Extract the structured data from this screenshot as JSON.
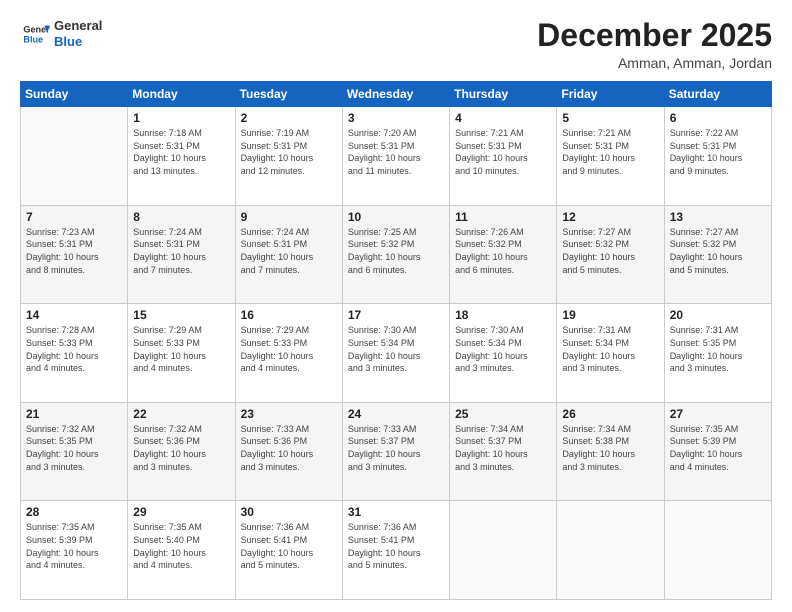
{
  "logo": {
    "general": "General",
    "blue": "Blue"
  },
  "title": "December 2025",
  "location": "Amman, Amman, Jordan",
  "days_header": [
    "Sunday",
    "Monday",
    "Tuesday",
    "Wednesday",
    "Thursday",
    "Friday",
    "Saturday"
  ],
  "weeks": [
    [
      {
        "day": "",
        "info": ""
      },
      {
        "day": "1",
        "info": "Sunrise: 7:18 AM\nSunset: 5:31 PM\nDaylight: 10 hours\nand 13 minutes."
      },
      {
        "day": "2",
        "info": "Sunrise: 7:19 AM\nSunset: 5:31 PM\nDaylight: 10 hours\nand 12 minutes."
      },
      {
        "day": "3",
        "info": "Sunrise: 7:20 AM\nSunset: 5:31 PM\nDaylight: 10 hours\nand 11 minutes."
      },
      {
        "day": "4",
        "info": "Sunrise: 7:21 AM\nSunset: 5:31 PM\nDaylight: 10 hours\nand 10 minutes."
      },
      {
        "day": "5",
        "info": "Sunrise: 7:21 AM\nSunset: 5:31 PM\nDaylight: 10 hours\nand 9 minutes."
      },
      {
        "day": "6",
        "info": "Sunrise: 7:22 AM\nSunset: 5:31 PM\nDaylight: 10 hours\nand 9 minutes."
      }
    ],
    [
      {
        "day": "7",
        "info": "Sunrise: 7:23 AM\nSunset: 5:31 PM\nDaylight: 10 hours\nand 8 minutes."
      },
      {
        "day": "8",
        "info": "Sunrise: 7:24 AM\nSunset: 5:31 PM\nDaylight: 10 hours\nand 7 minutes."
      },
      {
        "day": "9",
        "info": "Sunrise: 7:24 AM\nSunset: 5:31 PM\nDaylight: 10 hours\nand 7 minutes."
      },
      {
        "day": "10",
        "info": "Sunrise: 7:25 AM\nSunset: 5:32 PM\nDaylight: 10 hours\nand 6 minutes."
      },
      {
        "day": "11",
        "info": "Sunrise: 7:26 AM\nSunset: 5:32 PM\nDaylight: 10 hours\nand 6 minutes."
      },
      {
        "day": "12",
        "info": "Sunrise: 7:27 AM\nSunset: 5:32 PM\nDaylight: 10 hours\nand 5 minutes."
      },
      {
        "day": "13",
        "info": "Sunrise: 7:27 AM\nSunset: 5:32 PM\nDaylight: 10 hours\nand 5 minutes."
      }
    ],
    [
      {
        "day": "14",
        "info": "Sunrise: 7:28 AM\nSunset: 5:33 PM\nDaylight: 10 hours\nand 4 minutes."
      },
      {
        "day": "15",
        "info": "Sunrise: 7:29 AM\nSunset: 5:33 PM\nDaylight: 10 hours\nand 4 minutes."
      },
      {
        "day": "16",
        "info": "Sunrise: 7:29 AM\nSunset: 5:33 PM\nDaylight: 10 hours\nand 4 minutes."
      },
      {
        "day": "17",
        "info": "Sunrise: 7:30 AM\nSunset: 5:34 PM\nDaylight: 10 hours\nand 3 minutes."
      },
      {
        "day": "18",
        "info": "Sunrise: 7:30 AM\nSunset: 5:34 PM\nDaylight: 10 hours\nand 3 minutes."
      },
      {
        "day": "19",
        "info": "Sunrise: 7:31 AM\nSunset: 5:34 PM\nDaylight: 10 hours\nand 3 minutes."
      },
      {
        "day": "20",
        "info": "Sunrise: 7:31 AM\nSunset: 5:35 PM\nDaylight: 10 hours\nand 3 minutes."
      }
    ],
    [
      {
        "day": "21",
        "info": "Sunrise: 7:32 AM\nSunset: 5:35 PM\nDaylight: 10 hours\nand 3 minutes."
      },
      {
        "day": "22",
        "info": "Sunrise: 7:32 AM\nSunset: 5:36 PM\nDaylight: 10 hours\nand 3 minutes."
      },
      {
        "day": "23",
        "info": "Sunrise: 7:33 AM\nSunset: 5:36 PM\nDaylight: 10 hours\nand 3 minutes."
      },
      {
        "day": "24",
        "info": "Sunrise: 7:33 AM\nSunset: 5:37 PM\nDaylight: 10 hours\nand 3 minutes."
      },
      {
        "day": "25",
        "info": "Sunrise: 7:34 AM\nSunset: 5:37 PM\nDaylight: 10 hours\nand 3 minutes."
      },
      {
        "day": "26",
        "info": "Sunrise: 7:34 AM\nSunset: 5:38 PM\nDaylight: 10 hours\nand 3 minutes."
      },
      {
        "day": "27",
        "info": "Sunrise: 7:35 AM\nSunset: 5:39 PM\nDaylight: 10 hours\nand 4 minutes."
      }
    ],
    [
      {
        "day": "28",
        "info": "Sunrise: 7:35 AM\nSunset: 5:39 PM\nDaylight: 10 hours\nand 4 minutes."
      },
      {
        "day": "29",
        "info": "Sunrise: 7:35 AM\nSunset: 5:40 PM\nDaylight: 10 hours\nand 4 minutes."
      },
      {
        "day": "30",
        "info": "Sunrise: 7:36 AM\nSunset: 5:41 PM\nDaylight: 10 hours\nand 5 minutes."
      },
      {
        "day": "31",
        "info": "Sunrise: 7:36 AM\nSunset: 5:41 PM\nDaylight: 10 hours\nand 5 minutes."
      },
      {
        "day": "",
        "info": ""
      },
      {
        "day": "",
        "info": ""
      },
      {
        "day": "",
        "info": ""
      }
    ]
  ]
}
